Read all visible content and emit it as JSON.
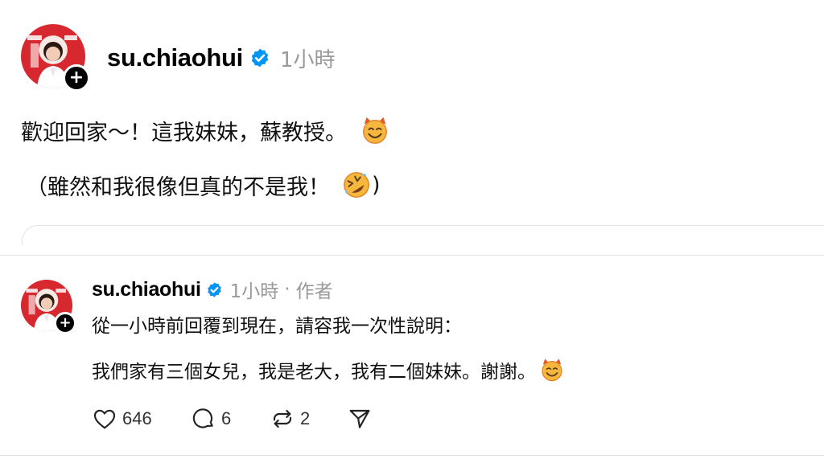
{
  "post": {
    "username": "su.chiaohui",
    "time": "1小時",
    "line1_text": "歡迎回家～！這我妹妹，蘇教授。",
    "line1_emoji": "smiling-face-with-horns-emoji",
    "line2_open": "（雖然和我很像但真的不是我！",
    "line2_emoji": "rolling-on-the-floor-laughing-emoji",
    "line2_close": ")"
  },
  "reply": {
    "username": "su.chiaohui",
    "time": "1小時",
    "separator": "·",
    "role": "作者",
    "line1_text": "從一小時前回覆到現在，請容我一次性說明：",
    "line2_text": "我們家有三個女兒，我是老大，我有二個妹妹。謝謝。",
    "line2_emoji": "smiling-face-with-horns-emoji",
    "likes": "646",
    "comments": "6",
    "reposts": "2"
  },
  "colors": {
    "verified_badge": "#0095f6",
    "muted_text": "#999999",
    "avatar_red": "#d7282f",
    "divider": "#e0e0e0"
  }
}
